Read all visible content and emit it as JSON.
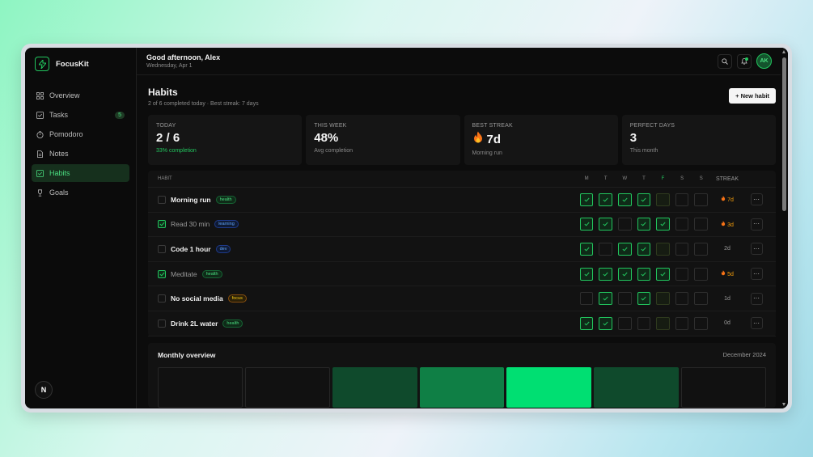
{
  "app": {
    "name": "FocusKit",
    "avatar_letter": "N",
    "user_initials": "AK"
  },
  "sidebar": {
    "items": [
      {
        "label": "Overview",
        "icon": "grid-icon"
      },
      {
        "label": "Tasks",
        "icon": "check-square-icon",
        "badge": "5"
      },
      {
        "label": "Pomodoro",
        "icon": "timer-icon"
      },
      {
        "label": "Notes",
        "icon": "document-icon"
      },
      {
        "label": "Habits",
        "icon": "check-square-icon",
        "active": true
      },
      {
        "label": "Goals",
        "icon": "trophy-icon"
      }
    ]
  },
  "header": {
    "greeting": "Good afternoon, Alex",
    "date": "Wednesday, Apr 1"
  },
  "page": {
    "title": "Habits",
    "subtitle": "2 of 6 completed today · Best streak: 7 days",
    "new_button": "+ New habit"
  },
  "stats": [
    {
      "label": "TODAY",
      "value": "2 / 6",
      "note": "33% completion",
      "note_color": "#22c55e"
    },
    {
      "label": "THIS WEEK",
      "value": "48%",
      "note": "Avg completion"
    },
    {
      "label": "BEST STREAK",
      "value": "7d",
      "note": "Morning run",
      "icon": "fire-icon"
    },
    {
      "label": "PERFECT DAYS",
      "value": "3",
      "note": "This month"
    }
  ],
  "table": {
    "header_habit": "HABIT",
    "header_streak": "STREAK",
    "days": [
      "M",
      "T",
      "W",
      "T",
      "F",
      "S",
      "S"
    ],
    "today_index": 4,
    "rows": [
      {
        "name": "Morning run",
        "tag": "health",
        "done": false,
        "week": [
          1,
          1,
          1,
          1,
          0,
          0,
          0
        ],
        "streak": "7d",
        "hot": true
      },
      {
        "name": "Read 30 min",
        "tag": "learning",
        "done": true,
        "week": [
          1,
          1,
          0,
          1,
          1,
          0,
          0
        ],
        "streak": "3d",
        "hot": true
      },
      {
        "name": "Code 1 hour",
        "tag": "dev",
        "done": false,
        "week": [
          1,
          0,
          1,
          1,
          0,
          0,
          0
        ],
        "streak": "2d",
        "hot": false
      },
      {
        "name": "Meditate",
        "tag": "health",
        "done": true,
        "week": [
          1,
          1,
          1,
          1,
          1,
          0,
          0
        ],
        "streak": "5d",
        "hot": true
      },
      {
        "name": "No social media",
        "tag": "focus",
        "done": false,
        "week": [
          0,
          1,
          0,
          1,
          0,
          0,
          0
        ],
        "streak": "1d",
        "hot": false
      },
      {
        "name": "Drink 2L water",
        "tag": "health",
        "done": false,
        "week": [
          1,
          1,
          0,
          0,
          0,
          0,
          0
        ],
        "streak": "0d",
        "hot": false
      }
    ]
  },
  "monthly": {
    "title": "Monthly overview",
    "period": "December 2024",
    "levels": [
      0,
      0,
      0.3,
      0.6,
      1,
      0.3,
      0
    ]
  },
  "colors": {
    "accent": "#22c55e",
    "streak": "#f59e0b"
  }
}
